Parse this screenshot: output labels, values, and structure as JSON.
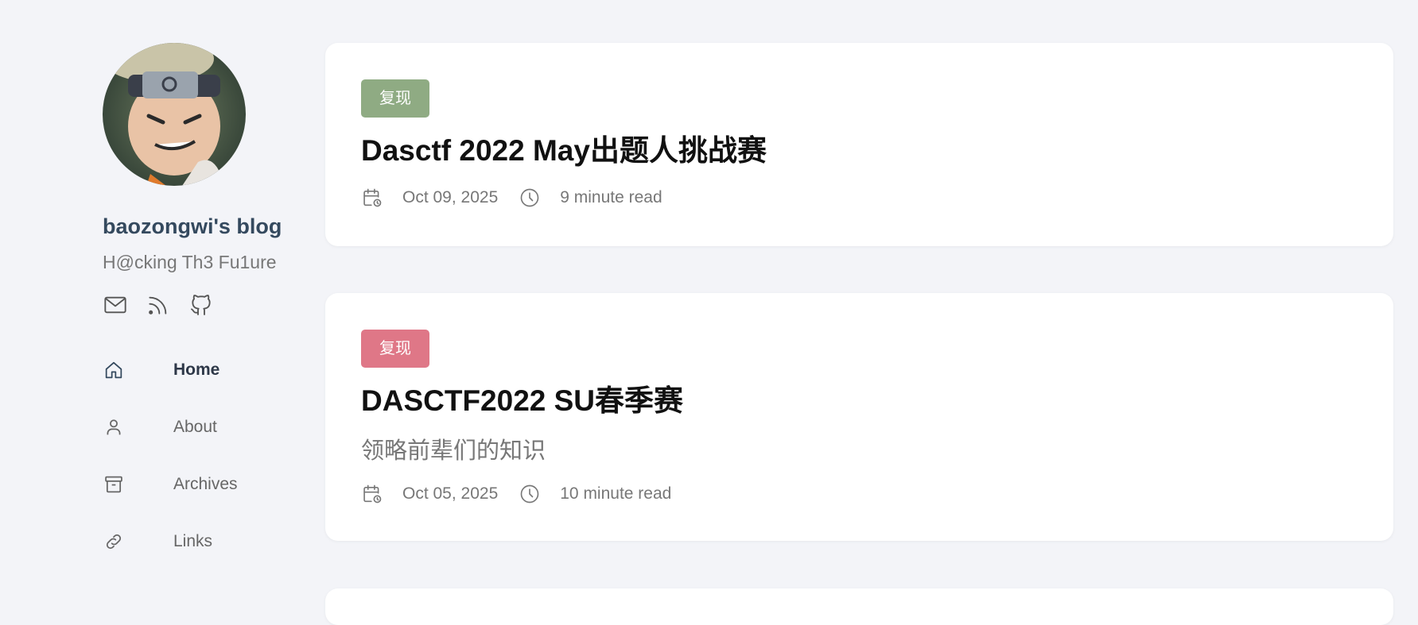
{
  "sidebar": {
    "blog_title": "baozongwi's blog",
    "blog_subtitle": "H@cking Th3 Fu1ure",
    "social_icons": [
      "mail-icon",
      "rss-icon",
      "github-icon"
    ],
    "nav": [
      {
        "label": "Home",
        "icon": "home-icon",
        "active": true
      },
      {
        "label": "About",
        "icon": "user-icon",
        "active": false
      },
      {
        "label": "Archives",
        "icon": "archive-icon",
        "active": false
      },
      {
        "label": "Links",
        "icon": "link-icon",
        "active": false
      }
    ]
  },
  "posts": [
    {
      "tag": "复现",
      "tag_color": "#8fab83",
      "title": "Dasctf 2022 May出题人挑战赛",
      "excerpt": "",
      "date": "Oct 09, 2025",
      "read_time": "9 minute read"
    },
    {
      "tag": "复现",
      "tag_color": "#df7787",
      "title": "DASCTF2022 SU春季赛",
      "excerpt": "领略前辈们的知识",
      "date": "Oct 05, 2025",
      "read_time": "10 minute read"
    }
  ],
  "colors": {
    "background": "#f3f4f8",
    "card": "#ffffff",
    "title_text": "#34495e",
    "muted_text": "#777777"
  }
}
